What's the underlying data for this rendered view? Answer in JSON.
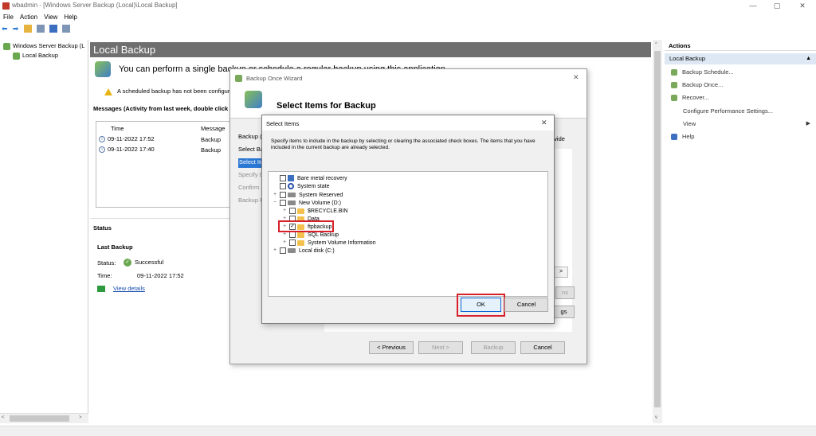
{
  "window": {
    "title": "wbadmin - [Windows Server Backup (Local)\\Local Backup]",
    "minimize": "—",
    "restore": "▢",
    "close": "✕"
  },
  "menu": [
    "File",
    "Action",
    "View",
    "Help"
  ],
  "toolbar": {
    "back": "⬅",
    "forward": "➡"
  },
  "tree": {
    "root": "Windows Server Backup (L",
    "child": "Local Backup"
  },
  "main": {
    "banner": "Local Backup",
    "headline": "You can perform a single backup or schedule a regular backup using this application.",
    "warning": "A scheduled backup has not been configured for this computer. Use the Backup Schedule Wizard to perform regular backups.",
    "messages_title": "Messages (Activity from last week, double click on the message to see details)",
    "columns": [
      "Time",
      "Message"
    ],
    "rows": [
      {
        "time": "09-11-2022 17:52",
        "message": "Backup"
      },
      {
        "time": "09-11-2022 17:40",
        "message": "Backup"
      }
    ],
    "status_title": "Status",
    "last_backup_title": "Last Backup",
    "status_label": "Status:",
    "status_value": "Successful",
    "time_label": "Time:",
    "time_value": "09-11-2022 17:52",
    "view_details": "View details"
  },
  "actions": {
    "header": "Actions",
    "section": "Local Backup",
    "items": [
      "Backup Schedule...",
      "Backup Once...",
      "Recover...",
      "Configure Performance Settings...",
      "View",
      "Help"
    ]
  },
  "wizard": {
    "title": "Backup Once Wizard",
    "heading": "Select Items for Backup",
    "steps": [
      "Backup Options",
      "Select Backup Configuration",
      "Select Items",
      "Specify Destination Type",
      "Confirmation",
      "Backup Progress"
    ],
    "steps_display": [
      "Backup (",
      "Select Ba",
      "Select Ite",
      "Specify D",
      "Confirm",
      "Backup P"
    ],
    "provide_text": "ovide",
    "partial_button_1": "ns",
    "partial_button_2": "gs",
    "buttons": {
      "previous": "< Previous",
      "next": "Next >",
      "backup": "Backup",
      "cancel": "Cancel"
    },
    "close": "✕"
  },
  "select_items": {
    "title": "Select Items",
    "description": "Specify items to include in the backup by selecting or clearing the associated check boxes. The items that you have included in the current backup are already selected.",
    "tree": [
      {
        "label": "Bare metal recovery",
        "checked": false,
        "level": 0,
        "expander": "",
        "icon": "bmr"
      },
      {
        "label": "System state",
        "checked": false,
        "level": 0,
        "expander": "",
        "icon": "sysst"
      },
      {
        "label": "System Reserved",
        "checked": false,
        "level": 0,
        "expander": "+",
        "icon": "drive"
      },
      {
        "label": "New Volume (D:)",
        "checked": false,
        "level": 0,
        "expander": "−",
        "icon": "drive"
      },
      {
        "label": "$RECYCLE.BIN",
        "checked": false,
        "level": 1,
        "expander": "+",
        "icon": "fold"
      },
      {
        "label": "Data",
        "checked": false,
        "level": 1,
        "expander": "+",
        "icon": "fold"
      },
      {
        "label": "ftpbackup",
        "checked": true,
        "level": 1,
        "expander": "+",
        "icon": "fold",
        "highlight": true
      },
      {
        "label": "SQL Backup",
        "checked": false,
        "level": 1,
        "expander": "+",
        "icon": "fold"
      },
      {
        "label": "System Volume Information",
        "checked": false,
        "level": 1,
        "expander": "+",
        "icon": "fold"
      },
      {
        "label": "Local disk (C:)",
        "checked": false,
        "level": 0,
        "expander": "+",
        "icon": "drive"
      }
    ],
    "ok": "OK",
    "cancel": "Cancel",
    "close": "✕"
  },
  "colors": {
    "banner": "#6f6f6f",
    "selection": "#2b78d4",
    "highlight_border": "#d6202a",
    "actions_section_bg": "#dde8f4"
  }
}
